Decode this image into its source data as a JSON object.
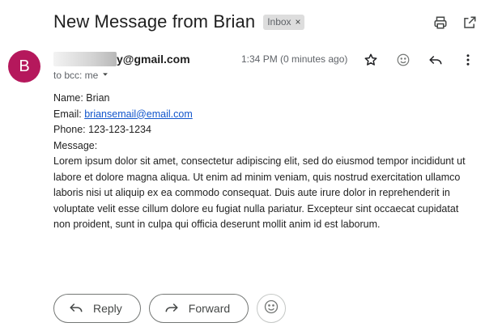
{
  "email": {
    "subject": "New Message from Brian",
    "label": "Inbox",
    "label_remove": "×",
    "avatar_letter": "B",
    "sender_visible": "y@gmail.com",
    "time": "1:34 PM (0 minutes ago)",
    "recipients": "to bcc: me"
  },
  "body": {
    "name_line": "Name: Brian",
    "email_prefix": "Email: ",
    "email_link": "briansemail@email.com",
    "phone_line": "Phone: 123-123-1234",
    "message_label": "Message:",
    "message_text": "Lorem ipsum dolor sit amet, consectetur adipiscing elit, sed do eiusmod tempor incididunt ut labore et dolore magna aliqua. Ut enim ad minim veniam, quis nostrud exercitation ullamco laboris nisi ut aliquip ex ea commodo consequat. Duis aute irure dolor in reprehenderit in voluptate velit esse cillum dolore eu fugiat nulla pariatur. Excepteur sint occaecat cupidatat non proident, sunt in culpa qui officia deserunt mollit anim id est laborum."
  },
  "actions": {
    "reply_label": "Reply",
    "forward_label": "Forward"
  },
  "icons": {
    "print": "print-icon",
    "open_new_window": "open-in-new-window-icon",
    "star": "star-icon",
    "emoji": "emoji-icon",
    "reply": "reply-icon",
    "more": "more-vert-icon",
    "dropdown": "chevron-down-icon",
    "forward": "forward-icon"
  },
  "colors": {
    "avatar_bg": "#b5185c",
    "link": "#1155cc",
    "label_bg": "#dddddd"
  }
}
